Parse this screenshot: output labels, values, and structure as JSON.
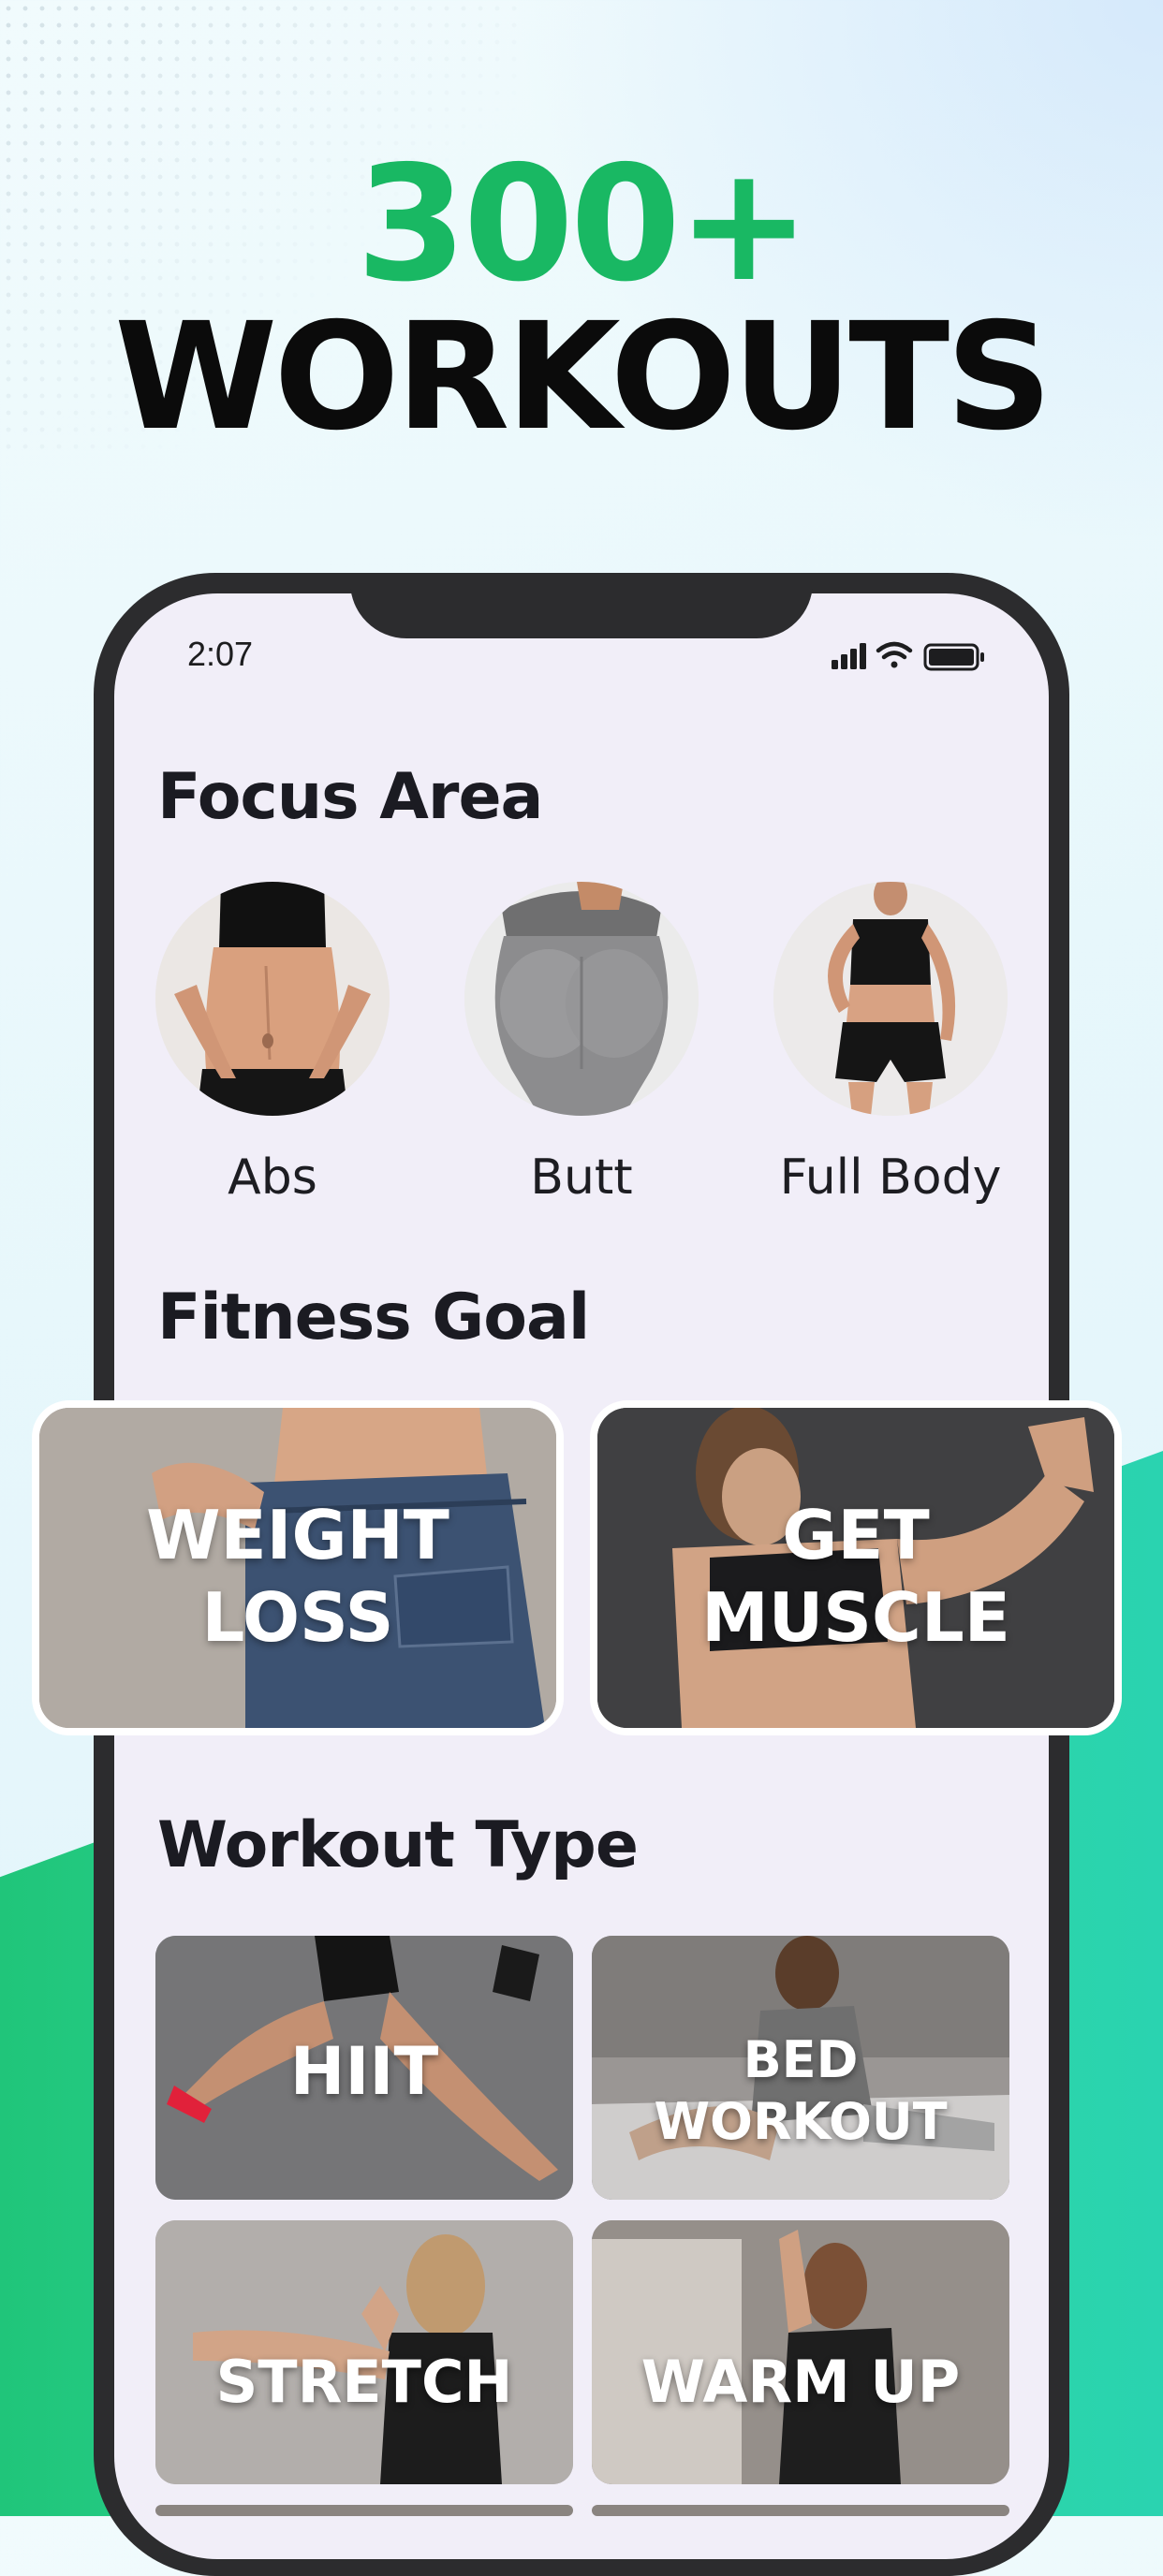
{
  "headline": {
    "number": "300+",
    "word": "WORKOUTS"
  },
  "status_bar": {
    "time": "2:07"
  },
  "focus_area": {
    "title": "Focus Area",
    "items": [
      {
        "label": "Abs"
      },
      {
        "label": "Butt"
      },
      {
        "label": "Full Body"
      }
    ]
  },
  "fitness_goal": {
    "title": "Fitness Goal",
    "cards": [
      {
        "line1": "WEIGHT",
        "line2": "LOSS"
      },
      {
        "line1": "GET",
        "line2": "MUSCLE"
      }
    ]
  },
  "workout_type": {
    "title": "Workout Type",
    "cards": [
      {
        "label": "HIIT"
      },
      {
        "line1": "BED",
        "line2": "WORKOUT"
      },
      {
        "label": "STRETCH"
      },
      {
        "label": "WARM UP"
      }
    ]
  },
  "colors": {
    "accent_green": "#19b863",
    "headline_black": "#0b0b0b",
    "screen_bg": "#f1eef8"
  }
}
